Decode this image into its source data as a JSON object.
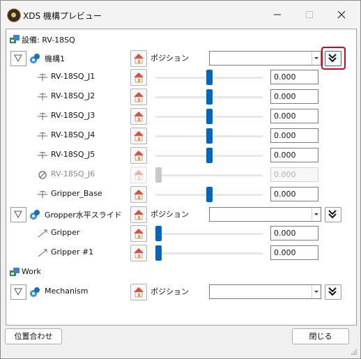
{
  "window": {
    "title": "XDS 機構プレビュー"
  },
  "device": {
    "label": "設備: RV-18SQ"
  },
  "groups": [
    {
      "name": "機構1",
      "position_label": "ポジション"
    },
    {
      "name": "Gropper水平スライド",
      "position_label": "ポジション"
    },
    {
      "name": "Mechanism",
      "position_label": "ポジション"
    }
  ],
  "joints": [
    {
      "name": "RV-18SQ_J1",
      "value": "0.000",
      "slider": 0.5
    },
    {
      "name": "RV-18SQ_J2",
      "value": "0.000",
      "slider": 0.5
    },
    {
      "name": "RV-18SQ_J3",
      "value": "0.000",
      "slider": 0.5
    },
    {
      "name": "RV-18SQ_J4",
      "value": "0.000",
      "slider": 0.5
    },
    {
      "name": "RV-18SQ_J5",
      "value": "0.000",
      "slider": 0.5
    },
    {
      "name": "RV-18SQ_J6",
      "value": "0.000",
      "slider": 0.0,
      "disabled": true
    },
    {
      "name": "Gripper_Base",
      "value": "0.000",
      "slider": 0.5
    },
    {
      "name": "Gripper",
      "value": "0.000",
      "slider": 0.0
    },
    {
      "name": "Gripper #1",
      "value": "0.000",
      "slider": 0.0
    }
  ],
  "work": {
    "label": "Work"
  },
  "footer": {
    "align_label": "位置合わせ",
    "close_label": "閉じる"
  },
  "colors": {
    "accent": "#0067c0",
    "highlight": "#e0001b"
  }
}
